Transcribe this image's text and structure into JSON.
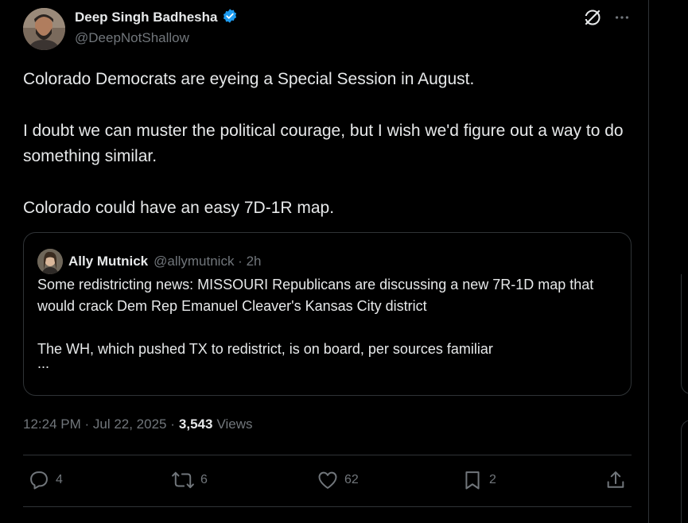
{
  "author": {
    "display_name": "Deep Singh Badhesha",
    "handle": "@DeepNotShallow",
    "verified": true,
    "verified_color": "#1d9bf0"
  },
  "top_actions": {
    "grok_icon": "grok-icon",
    "more_icon": "more-horizontal-icon"
  },
  "tweet": {
    "paragraphs": [
      "Colorado Democrats are eyeing a Special Session in August.",
      "I doubt we can muster the political courage, but I wish we'd figure out a way to do something similar.",
      "Colorado could have an easy 7D-1R map."
    ]
  },
  "quote": {
    "name": "Ally Mutnick",
    "handle_time": "@allymutnick · 2h",
    "paragraphs": [
      "Some redistricting news: MISSOURI Republicans are discussing a new 7R-1D map that would crack Dem Rep Emanuel Cleaver's Kansas City district",
      "The WH, which pushed TX to redistrict, is on board, per sources familiar"
    ],
    "ellipsis": "..."
  },
  "meta": {
    "time_date": "12:24 PM · Jul 22, 2025 ·",
    "views_count": "3,543",
    "views_label": "Views"
  },
  "actions": {
    "reply_count": "4",
    "repost_count": "6",
    "like_count": "62",
    "bookmark_count": "2"
  },
  "colors": {
    "background": "#000000",
    "text": "#e7e9ea",
    "muted": "#71767b",
    "border": "#2f3336"
  }
}
